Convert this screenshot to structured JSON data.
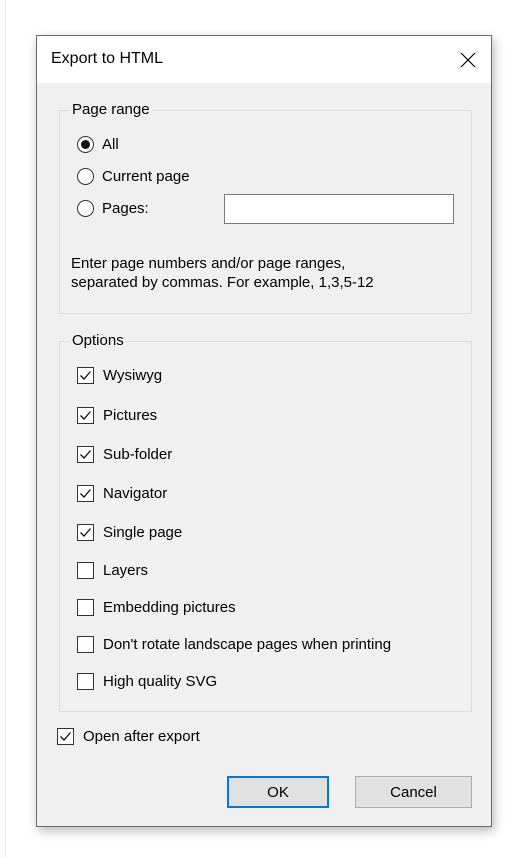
{
  "dialog": {
    "title": "Export to HTML"
  },
  "page_range": {
    "legend": "Page range",
    "options": [
      {
        "label": "All",
        "checked": true
      },
      {
        "label": "Current page",
        "checked": false
      },
      {
        "label": "Pages:",
        "checked": false
      }
    ],
    "pages_input_value": "",
    "help_text": "Enter page numbers and/or page ranges,\nseparated by commas. For example, 1,3,5-12"
  },
  "options": {
    "legend": "Options",
    "items": [
      {
        "label": "Wysiwyg",
        "checked": true
      },
      {
        "label": "Pictures",
        "checked": true
      },
      {
        "label": "Sub-folder",
        "checked": true
      },
      {
        "label": "Navigator",
        "checked": true
      },
      {
        "label": "Single page",
        "checked": true
      },
      {
        "label": "Layers",
        "checked": false
      },
      {
        "label": "Embedding pictures",
        "checked": false
      },
      {
        "label": "Don't rotate landscape pages when printing",
        "checked": false
      },
      {
        "label": "High quality SVG",
        "checked": false
      }
    ]
  },
  "open_after_export": {
    "label": "Open after export",
    "checked": true
  },
  "buttons": {
    "ok": "OK",
    "cancel": "Cancel"
  },
  "colors": {
    "dialog_bg": "#f0f0f0",
    "default_button_border": "#0078d7"
  }
}
